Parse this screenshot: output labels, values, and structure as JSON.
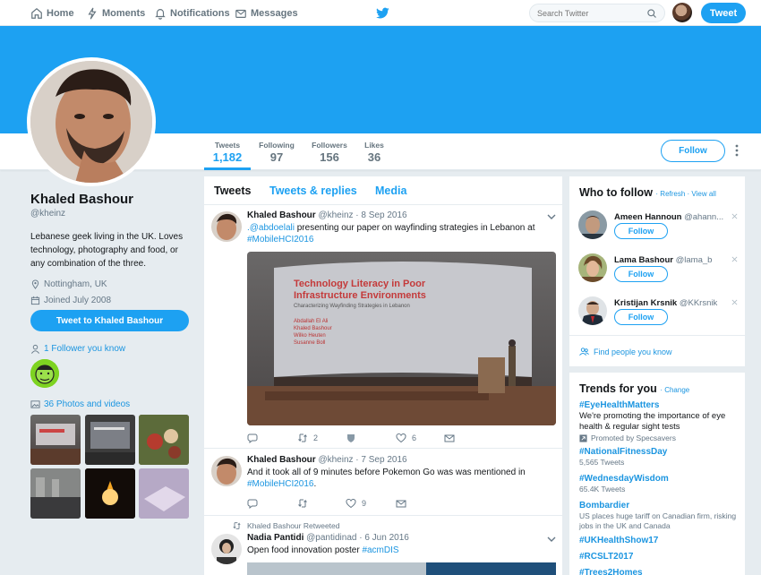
{
  "nav": {
    "home": "Home",
    "moments": "Moments",
    "notifications": "Notifications",
    "messages": "Messages",
    "search_placeholder": "Search Twitter",
    "tweet_button": "Tweet"
  },
  "stats": [
    {
      "label": "Tweets",
      "value": "1,182"
    },
    {
      "label": "Following",
      "value": "97"
    },
    {
      "label": "Followers",
      "value": "156"
    },
    {
      "label": "Likes",
      "value": "36"
    }
  ],
  "follow_button": "Follow",
  "profile": {
    "name": "Khaled Bashour",
    "handle": "@kheinz",
    "bio": "Lebanese geek living in the UK. Loves technology, photography and food, or any combination of the three.",
    "location": "Nottingham, UK",
    "joined": "Joined July 2008",
    "tweet_to": "Tweet to Khaled Bashour",
    "followers_you_know": "1 Follower you know",
    "photos_videos": "36 Photos and videos"
  },
  "tabs": [
    "Tweets",
    "Tweets & replies",
    "Media"
  ],
  "tweets": [
    {
      "name": "Khaled Bashour",
      "handle": "@kheinz",
      "date": "8 Sep 2016",
      "mention": ".@abdoelali",
      "text": " presenting our paper on wayfinding strategies in Lebanon at ",
      "hashtag": "#MobileHCI2016",
      "retweets": "2",
      "likes": "6",
      "media": {
        "slide_title_1": "Technology Literacy in Poor",
        "slide_title_2": "Infrastructure Environments",
        "slide_subtitle": "Characterizing Wayfinding Strategies in Lebanon",
        "slide_authors": [
          "Abdallah El Ali",
          "Khaled Bashour",
          "Wilko Heuten",
          "Susanne Boll"
        ]
      }
    },
    {
      "name": "Khaled Bashour",
      "handle": "@kheinz",
      "date": "7 Sep 2016",
      "text": "And it took all of 9 minutes before Pokemon Go was was mentioned in ",
      "hashtag": "#MobileHCI2016",
      "text_end": ".",
      "likes": "9"
    },
    {
      "retweeted_by": "Khaled Bashour Retweeted",
      "name": "Nadia Pantidi",
      "handle": "@pantidinad",
      "date": "6 Jun 2016",
      "text": "Open food innovation poster ",
      "hashtag": "#acmDIS"
    }
  ],
  "who_to_follow": {
    "title": "Who to follow",
    "refresh": "Refresh",
    "view_all": "View all",
    "items": [
      {
        "name": "Ameen Hannoun",
        "handle": "@ahann..."
      },
      {
        "name": "Lama Bashour",
        "handle": "@lama_b"
      },
      {
        "name": "Kristijan Krsnik",
        "handle": "@KKrsnik"
      }
    ],
    "find_people": "Find people you know"
  },
  "trends": {
    "title": "Trends for you",
    "change": "Change",
    "items": [
      {
        "name": "#EyeHealthMatters",
        "desc": "We're promoting the importance of eye health & regular sight tests",
        "promoted": "Promoted by Specsavers"
      },
      {
        "name": "#NationalFitnessDay",
        "sub": "5,565 Tweets"
      },
      {
        "name": "#WednesdayWisdom",
        "sub": "65.4K Tweets"
      },
      {
        "name": "Bombardier",
        "sub": "US places huge tariff on Canadian firm, risking jobs in the UK and Canada"
      },
      {
        "name": "#UKHealthShow17"
      },
      {
        "name": "#RCSLT2017"
      },
      {
        "name": "#Trees2Homes"
      }
    ]
  },
  "colors": {
    "accent": "#1da1f2",
    "link": "#1b95e0",
    "background": "#e6ecf0"
  }
}
